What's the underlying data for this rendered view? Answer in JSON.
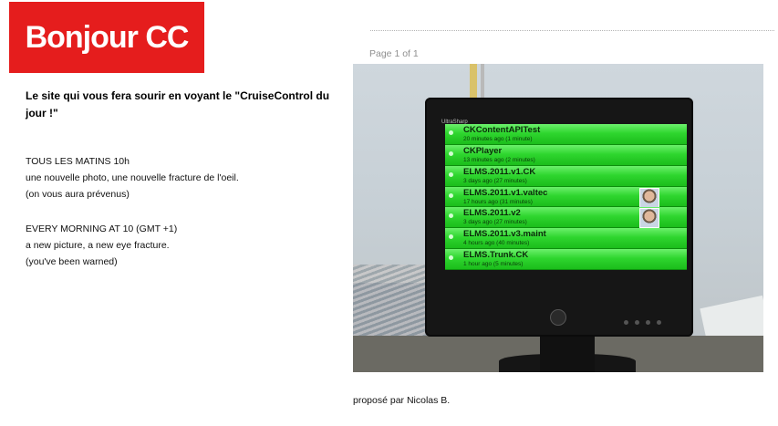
{
  "header": {
    "logo_text": "Bonjour CC"
  },
  "sidebar": {
    "tagline": "Le site qui vous fera sourir en voyant le \"CruiseControl du jour !\"",
    "french": {
      "line1": "TOUS LES MATINS 10h",
      "line2": "une nouvelle photo, une nouvelle fracture de l'oeil.",
      "line3": "(on vous aura prévenus)"
    },
    "english": {
      "line1": "EVERY MORNING AT 10 (GMT +1)",
      "line2": "a new picture, a new eye fracture.",
      "line3": "(you've been warned)"
    }
  },
  "main": {
    "page_info": "Page 1 of 1",
    "credit": "proposé par Nicolas B.",
    "photo": {
      "monitor_brand": "UltraSharp",
      "builds": [
        {
          "name": "CKContentAPITest",
          "time": "20 minutes ago",
          "duration": "(1 minute)",
          "has_avatar": false
        },
        {
          "name": "CKPlayer",
          "time": "13 minutes ago",
          "duration": "(2 minutes)",
          "has_avatar": false
        },
        {
          "name": "ELMS.2011.v1.CK",
          "time": "3 days ago",
          "duration": "(27 minutes)",
          "has_avatar": false
        },
        {
          "name": "ELMS.2011.v1.valtec",
          "time": "17 hours ago",
          "duration": "(31 minutes)",
          "has_avatar": true
        },
        {
          "name": "ELMS.2011.v2",
          "time": "3 days ago",
          "duration": "(27 minutes)",
          "has_avatar": true
        },
        {
          "name": "ELMS.2011.v3.maint",
          "time": "4 hours ago",
          "duration": "(40 minutes)",
          "has_avatar": false
        },
        {
          "name": "ELMS.Trunk.CK",
          "time": "1 hour ago",
          "duration": "(5 minutes)",
          "has_avatar": false
        }
      ]
    }
  }
}
